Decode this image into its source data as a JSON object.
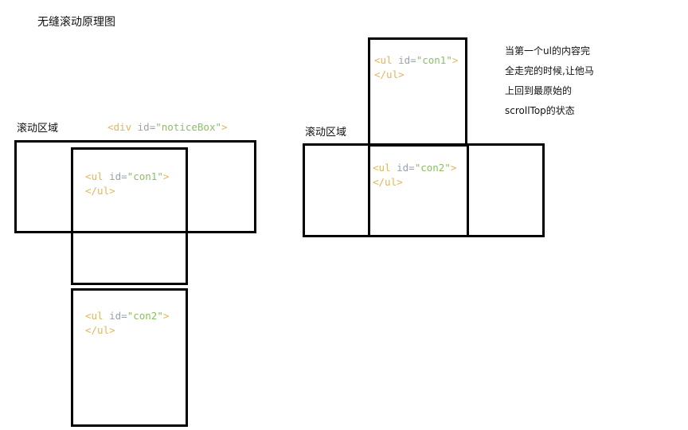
{
  "title": "无缝滚动原理图",
  "left": {
    "area_label": "滚动区域",
    "container": {
      "open": "<div ",
      "attr": "id=",
      "value": "\"noticeBox\"",
      "close": ">"
    },
    "ul1": {
      "open": "<ul ",
      "attr": "id=",
      "value": "\"con1\"",
      "close": ">",
      "end": "</ul>"
    },
    "ul2": {
      "open": "<ul ",
      "attr": "id=",
      "value": "\"con2\"",
      "close": ">",
      "end": "</ul>"
    }
  },
  "right": {
    "area_label": "滚动区域",
    "ul1": {
      "open": "<ul ",
      "attr": "id=",
      "value": "\"con1\"",
      "close": ">",
      "end": "</ul>"
    },
    "ul2": {
      "open": "<ul ",
      "attr": "id=",
      "value": "\"con2\"",
      "close": ">",
      "end": "</ul>"
    },
    "note_lines": [
      "当第一个ul的内容完",
      "全走完的时候,让他马",
      "上回到最原始的",
      "scrollTop的状态"
    ]
  }
}
